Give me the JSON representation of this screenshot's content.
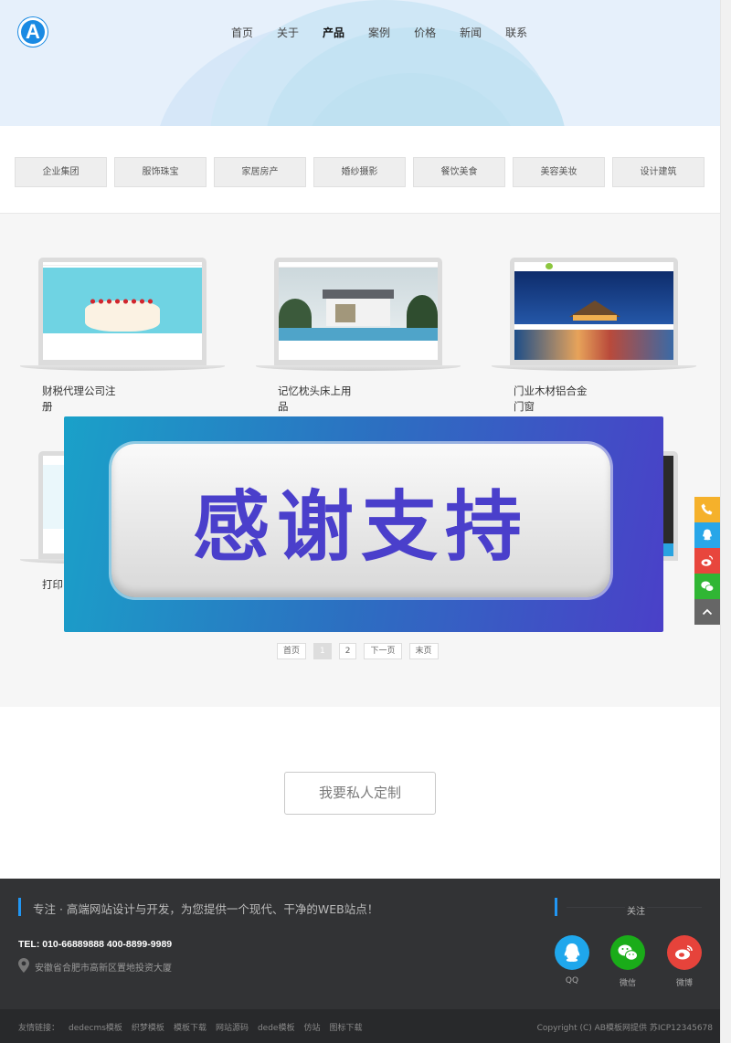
{
  "header": {
    "logo_letter": "A",
    "nav": [
      "首页",
      "关于",
      "产品",
      "案例",
      "价格",
      "新闻",
      "联系"
    ],
    "active_nav": "产品"
  },
  "categories": [
    "企业集团",
    "服饰珠宝",
    "家居房产",
    "婚纱摄影",
    "餐饮美食",
    "美容美妆",
    "设计建筑"
  ],
  "products": [
    {
      "title": "财税代理公司注册",
      "thumb": "cake"
    },
    {
      "title": "记忆枕头床上用品",
      "thumb": "villa"
    },
    {
      "title": "门业木材铝合金门窗",
      "thumb": "resort"
    },
    {
      "title": "打印",
      "thumb": "light"
    }
  ],
  "overlay": {
    "text": "感谢支持"
  },
  "pagination": [
    "首页",
    "1",
    "2",
    "下一页",
    "末页"
  ],
  "pagination_current": "1",
  "custom_button": "我要私人定制",
  "footer": {
    "slogan": "专注 · 高端网站设计与开发，为您提供一个现代、干净的WEB站点！",
    "tel": "TEL: 010-66889888 400-8899-9989",
    "address": "安徽省合肥市高新区置地投资大厦",
    "follow_title": "关注",
    "social": [
      {
        "label": "QQ",
        "color": "#1fa7ec"
      },
      {
        "label": "微信",
        "color": "#1aac19"
      },
      {
        "label": "微博",
        "color": "#e6433b"
      }
    ],
    "links": [
      "友情链接：",
      "dedecms模板",
      "织梦模板",
      "模板下载",
      "网站源码",
      "dede模板",
      "仿站",
      "图标下载"
    ],
    "copyright": "Copyright (C) AB模板网提供 苏ICP12345678"
  },
  "float_bar": [
    {
      "icon": "phone-icon",
      "color": "#f5b12b"
    },
    {
      "icon": "qq-icon",
      "color": "#28a6e8"
    },
    {
      "icon": "weibo-icon",
      "color": "#e8463d"
    },
    {
      "icon": "wechat-icon",
      "color": "#30b634"
    },
    {
      "icon": "back-to-top-icon",
      "color": "#666666"
    }
  ]
}
